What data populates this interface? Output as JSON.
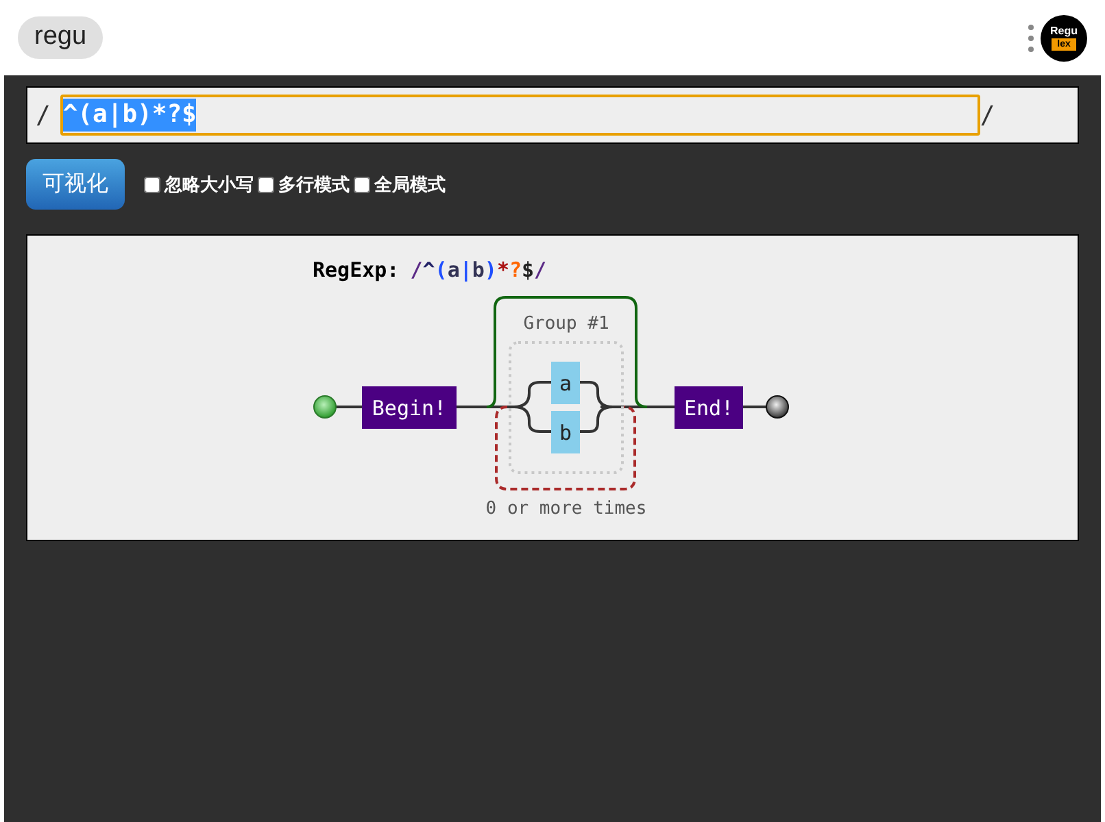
{
  "header": {
    "title": "regu",
    "logo": {
      "top": "Regu",
      "bottom": "lex"
    }
  },
  "pattern": {
    "prefix": "/",
    "value": "^(a|b)*?$",
    "selected": true,
    "suffix": "/"
  },
  "visualize_button": "可视化",
  "options": [
    {
      "label": "忽略大小写",
      "checked": false
    },
    {
      "label": "多行模式",
      "checked": false
    },
    {
      "label": "全局模式",
      "checked": false
    }
  ],
  "diagram": {
    "caption": "RegExp:",
    "tokens": [
      {
        "text": "/",
        "color": "#5b2a86"
      },
      {
        "text": "^",
        "color": "#222266"
      },
      {
        "text": "(",
        "color": "#1f4fff"
      },
      {
        "text": "a",
        "color": "#333355"
      },
      {
        "text": "|",
        "color": "#1f4fff"
      },
      {
        "text": "b",
        "color": "#333355"
      },
      {
        "text": ")",
        "color": "#1f4fff"
      },
      {
        "text": "*",
        "color": "#aa1111"
      },
      {
        "text": "?",
        "color": "#ff6600"
      },
      {
        "text": "$",
        "color": "#222222"
      },
      {
        "text": "/",
        "color": "#5b2a86"
      }
    ],
    "begin": "Begin!",
    "end": "End!",
    "group_label": "Group #1",
    "alternatives": [
      "a",
      "b"
    ],
    "loop_label": "0 or more times"
  }
}
